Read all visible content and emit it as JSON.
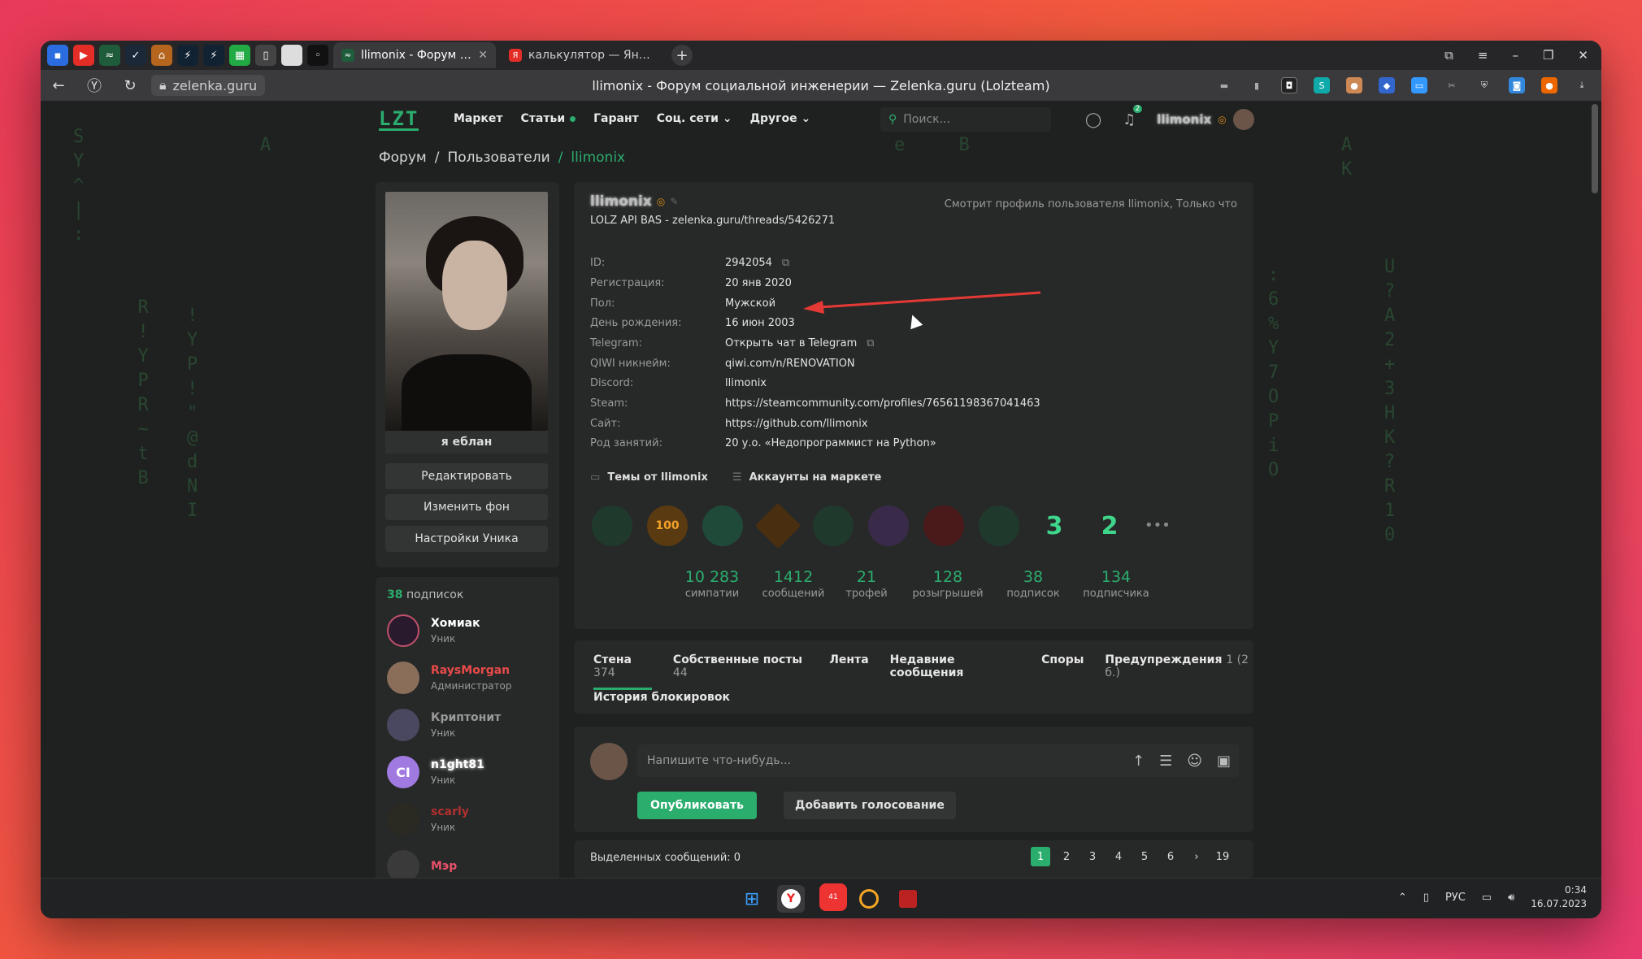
{
  "browser": {
    "tabs": [
      {
        "title": "llimonix - Форум социа",
        "active": true
      },
      {
        "title": "калькулятор — Яндекс: на",
        "active": false
      }
    ],
    "new_tab": "+",
    "url": "zelenka.guru",
    "page_title": "llimonix - Форум социальной инженерии — Zelenka.guru (Lolzteam)"
  },
  "site": {
    "logo": "LZT",
    "nav": [
      "Маркет",
      "Статьи",
      "Гарант",
      "Соц. сети",
      "Другое"
    ],
    "search_placeholder": "Поиск...",
    "notifications_count": "2",
    "username": "llimonix"
  },
  "breadcrumb": [
    "Форум",
    "/",
    "Пользователи",
    "/",
    "llimonix"
  ],
  "sidebar": {
    "status": "я еблан",
    "buttons": [
      "Редактировать",
      "Изменить фон",
      "Настройки Уника"
    ],
    "subs_count": "38",
    "subs_label": "подписок",
    "subscriptions": [
      {
        "name": "Хомиак",
        "role": "Уник",
        "color": "#ffffff"
      },
      {
        "name": "RaysMorgan",
        "role": "Администратор",
        "color": "#e84a4a"
      },
      {
        "name": "Криптонит",
        "role": "Уник",
        "color": "#9a9a9a"
      },
      {
        "name": "n1ght81",
        "role": "Уник",
        "color": "#ffffff"
      },
      {
        "name": "scarly",
        "role": "Уник",
        "color": "#b03030"
      },
      {
        "name": "Мэр",
        "role": "",
        "color": "#e8506a"
      }
    ]
  },
  "profile": {
    "username": "llimonix",
    "viewing": "Смотрит профиль пользователя llimonix, Только что",
    "title": "LOLZ API BAS - zelenka.guru/threads/5426271",
    "fields": [
      {
        "k": "ID:",
        "v": "2942054"
      },
      {
        "k": "Регистрация:",
        "v": "20 янв 2020"
      },
      {
        "k": "Пол:",
        "v": "Мужской"
      },
      {
        "k": "День рождения:",
        "v": "16 июн 2003"
      },
      {
        "k": "Telegram:",
        "v": "Открыть чат в Telegram"
      },
      {
        "k": "QIWI никнейм:",
        "v": "qiwi.com/n/RENOVATION"
      },
      {
        "k": "Discord:",
        "v": "llimonix"
      },
      {
        "k": "Steam:",
        "v": "https://steamcommunity.com/profiles/76561198367041463"
      },
      {
        "k": "Сайт:",
        "v": "https://github.com/llimonix"
      },
      {
        "k": "Род занятий:",
        "v": "20 у.о. «Недопрограммист на Python»"
      }
    ],
    "links": [
      "Темы от llimonix",
      "Аккаунты на маркете"
    ],
    "trophies": [
      "",
      "100",
      "",
      "",
      "",
      "",
      "",
      "",
      "3",
      "2"
    ],
    "more": "•••",
    "stats": [
      {
        "n": "10 283",
        "l": "симпатии"
      },
      {
        "n": "1412",
        "l": "сообщений"
      },
      {
        "n": "21",
        "l": "трофей"
      },
      {
        "n": "128",
        "l": "розыгрышей"
      },
      {
        "n": "38",
        "l": "подписок"
      },
      {
        "n": "134",
        "l": "подписчика"
      }
    ]
  },
  "tabs": [
    {
      "label": "Стена",
      "count": "374"
    },
    {
      "label": "Собственные посты",
      "count": "44"
    },
    {
      "label": "Лента",
      "count": ""
    },
    {
      "label": "Недавние сообщения",
      "count": ""
    },
    {
      "label": "Споры",
      "count": ""
    },
    {
      "label": "Предупреждения",
      "count": "1 (2 б.)"
    },
    {
      "label": "История блокировок",
      "count": ""
    }
  ],
  "composer": {
    "placeholder": "Напишите что-нибудь...",
    "publish": "Опубликовать",
    "poll": "Добавить голосование"
  },
  "selected": "Выделенных сообщений: 0",
  "pager": [
    "1",
    "2",
    "3",
    "4",
    "5",
    "6",
    "›",
    "19"
  ],
  "taskbar": {
    "telegram_badge": "41",
    "lang": "РУС",
    "time": "0:34",
    "date": "16.07.2023"
  },
  "colors": {
    "accent": "#2bad6e",
    "bg": "#1f2120",
    "panel": "#272928"
  }
}
